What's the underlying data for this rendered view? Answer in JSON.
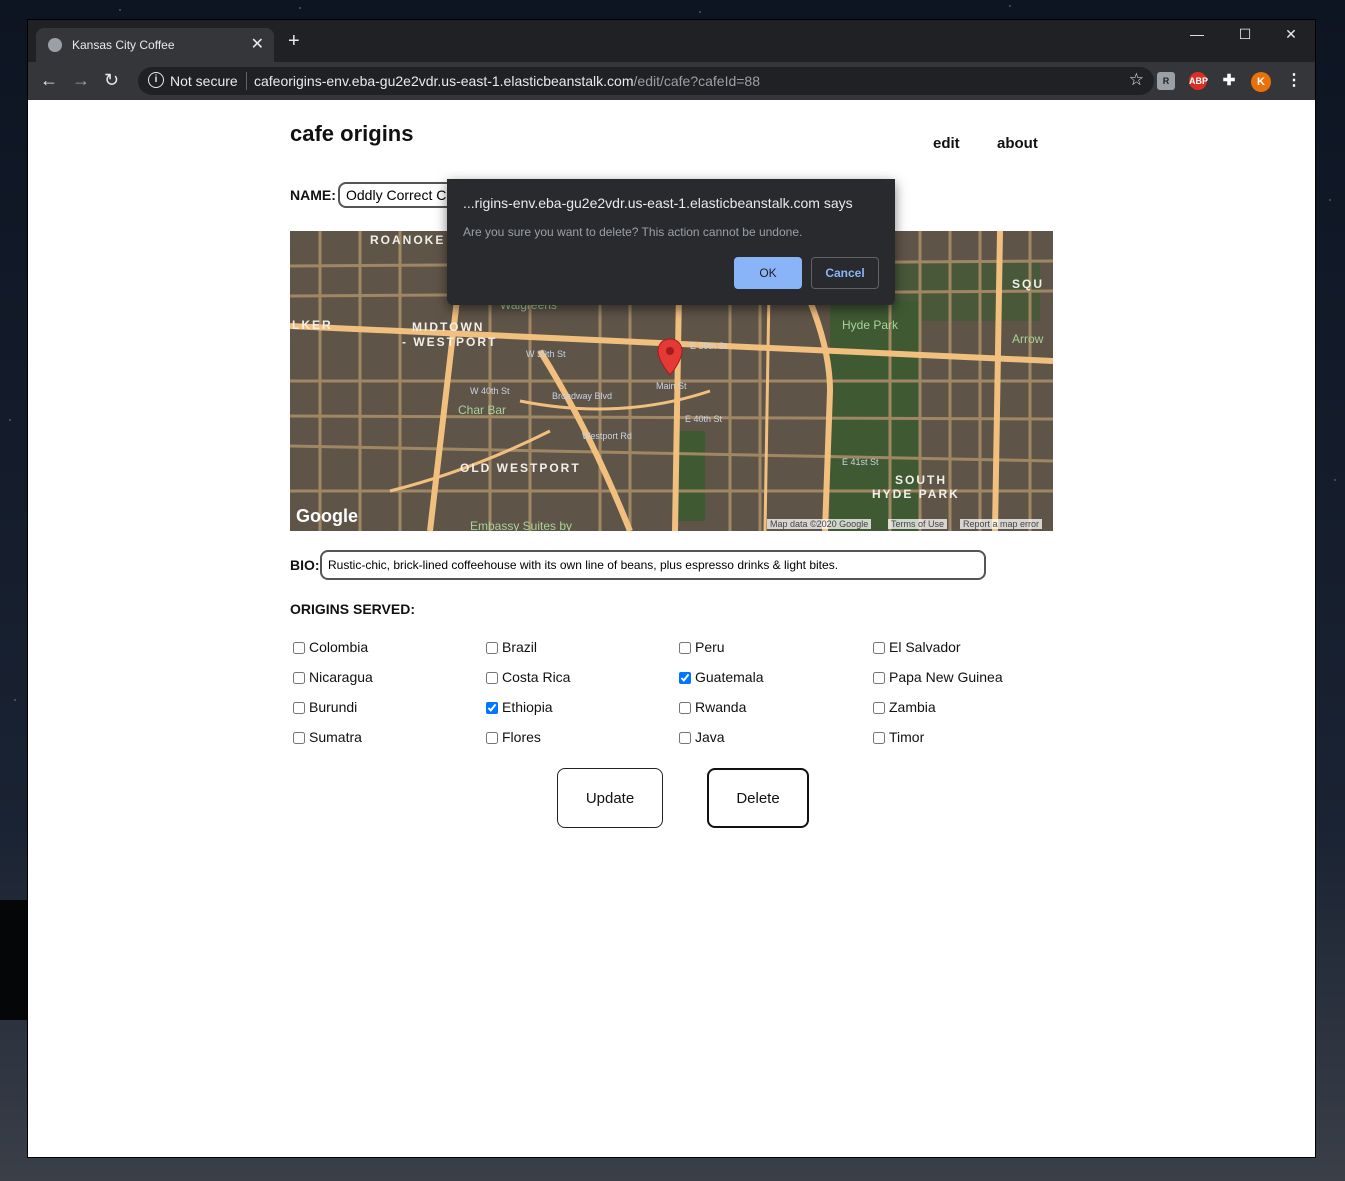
{
  "browser": {
    "tab_title": "Kansas City Coffee",
    "tab_close": "✕",
    "new_tab": "+",
    "not_secure": "Not secure",
    "url_host": "cafeorigins-env.eba-gu2e2vdr.us-east-1.elasticbeanstalk.com",
    "url_path": "/edit/cafe?cafeId=88",
    "profile_initial": "K",
    "ext_abp": "ABP",
    "win_minimize": "—",
    "win_maximize": "☐",
    "win_close": "✕"
  },
  "site": {
    "brand": "cafe origins",
    "nav": {
      "edit": "edit",
      "about": "about"
    }
  },
  "form": {
    "name_label": "NAME:",
    "name_value": "Oddly Correct Co",
    "bio_label": "BIO:",
    "bio_value": "Rustic-chic, brick-lined coffeehouse with its own line of beans, plus espresso drinks & light bites.",
    "origins_label": "ORIGINS SERVED:",
    "origins": [
      {
        "label": "Colombia",
        "checked": false
      },
      {
        "label": "Brazil",
        "checked": false
      },
      {
        "label": "Peru",
        "checked": false
      },
      {
        "label": "El Salvador",
        "checked": false
      },
      {
        "label": "Nicaragua",
        "checked": false
      },
      {
        "label": "Costa Rica",
        "checked": false
      },
      {
        "label": "Guatemala",
        "checked": true
      },
      {
        "label": "Papa New Guinea",
        "checked": false
      },
      {
        "label": "Burundi",
        "checked": false
      },
      {
        "label": "Ethiopia",
        "checked": true
      },
      {
        "label": "Rwanda",
        "checked": false
      },
      {
        "label": "Zambia",
        "checked": false
      },
      {
        "label": "Sumatra",
        "checked": false
      },
      {
        "label": "Flores",
        "checked": false
      },
      {
        "label": "Java",
        "checked": false
      },
      {
        "label": "Timor",
        "checked": false
      }
    ],
    "update_label": "Update",
    "delete_label": "Delete"
  },
  "map": {
    "areas": [
      "ROANOKE",
      "MIDTOWN",
      "- WESTPORT",
      "OLD WESTPORT",
      "SOUTH",
      "HYDE PARK",
      "SQU",
      "LKER"
    ],
    "pois": [
      "Walgreens",
      "Char Bar",
      "Hyde Park",
      "Arrow",
      "Embassy Suites by"
    ],
    "streets": [
      "W 39th St",
      "E 39th St",
      "W 40th St",
      "E 40th St",
      "E 41st St",
      "Main St",
      "Broadway Blvd",
      "Westport Rd"
    ],
    "logo": "Google",
    "footer": [
      "Map data ©2020 Google",
      "Terms of Use",
      "Report a map error"
    ]
  },
  "dialog": {
    "title": "...rigins-env.eba-gu2e2vdr.us-east-1.elasticbeanstalk.com says",
    "message": "Are you sure you want to delete? This action cannot be undone.",
    "ok": "OK",
    "cancel": "Cancel"
  },
  "colors": {
    "map_bg": "#5f5448",
    "road": "#f2c07e",
    "park": "#3f5a33",
    "pin": "#e53935",
    "dialog_bg": "#292a2d",
    "accent": "#8ab4f8",
    "checkbox": "#1a73e8"
  }
}
